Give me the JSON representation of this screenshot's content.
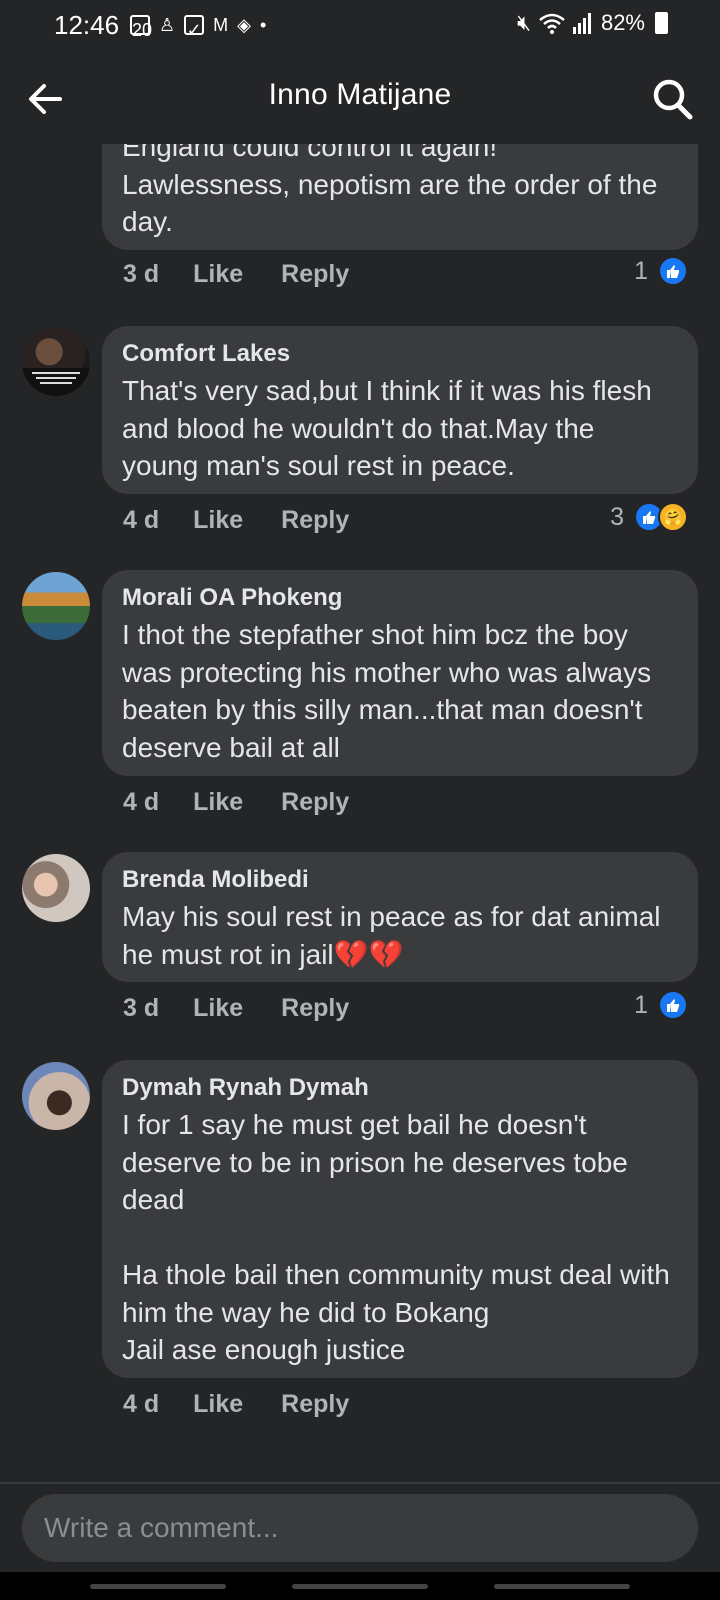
{
  "status_bar": {
    "time": "12:46",
    "calendar_day": "20",
    "battery": "82%"
  },
  "header": {
    "title": "Inno Matijane"
  },
  "comments": [
    {
      "author": "",
      "text": "England could control it again!\nLawlessness, nepotism are the order of the day.",
      "time": "3 d",
      "like_label": "Like",
      "reply_label": "Reply",
      "reaction_count": "1",
      "reactions": [
        "like"
      ]
    },
    {
      "author": "Comfort Lakes",
      "text": "That's very sad,but I think if it was his flesh and blood he wouldn't do that.May the young man's soul rest in peace.",
      "time": "4 d",
      "like_label": "Like",
      "reply_label": "Reply",
      "reaction_count": "3",
      "reactions": [
        "like",
        "care"
      ]
    },
    {
      "author": "Morali OA Phokeng",
      "text": "I thot the stepfather shot him bcz the boy was protecting his mother who was always beaten by this silly man...that man doesn't deserve bail at all",
      "time": "4 d",
      "like_label": "Like",
      "reply_label": "Reply",
      "reaction_count": "",
      "reactions": []
    },
    {
      "author": "Brenda Molibedi",
      "text": "May his soul rest in peace as for dat animal he must rot in jail💔💔",
      "time": "3 d",
      "like_label": "Like",
      "reply_label": "Reply",
      "reaction_count": "1",
      "reactions": [
        "like"
      ]
    },
    {
      "author": "Dymah Rynah Dymah",
      "text": "I for 1 say he must get bail he doesn't deserve to be in prison he deserves tobe dead\n\nHa thole bail then community must deal with him the way he did to Bokang\nJail ase enough justice",
      "time": "4 d",
      "like_label": "Like",
      "reply_label": "Reply",
      "reaction_count": "",
      "reactions": []
    }
  ],
  "composer": {
    "placeholder": "Write a comment..."
  },
  "colors": {
    "background": "#242527",
    "bubble": "#3a3b3c",
    "secondary_text": "#b0b3b8",
    "like_blue": "#1877f2"
  }
}
